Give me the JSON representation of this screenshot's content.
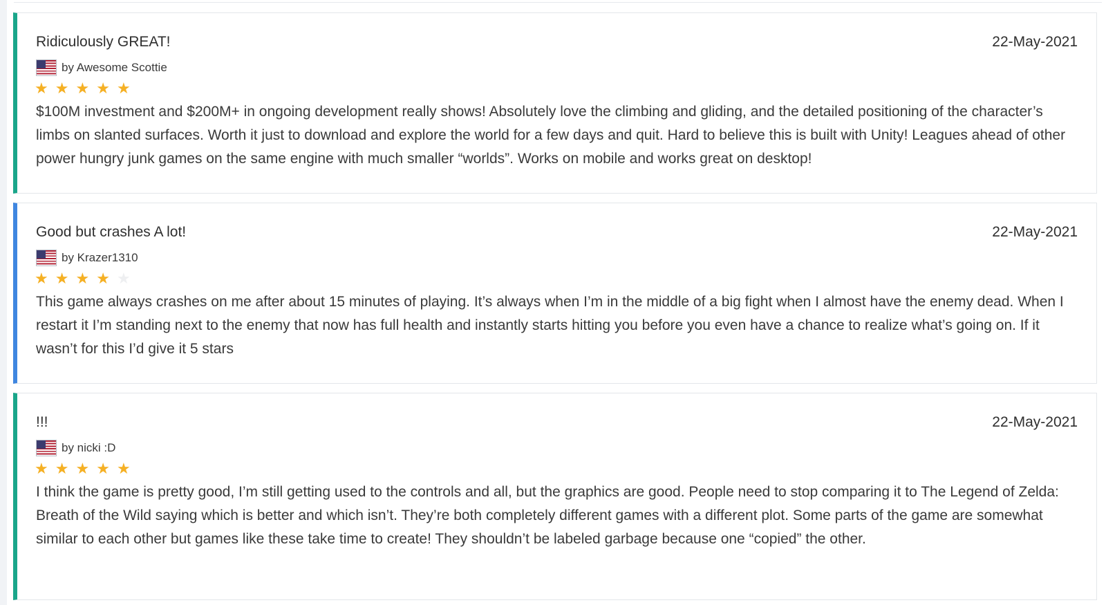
{
  "colors": {
    "accent_green": "#1aa68a",
    "accent_blue": "#3f86e0",
    "star_filled": "#f5b024",
    "star_empty": "#eeeff1"
  },
  "reviews": [
    {
      "title": "Ridiculously GREAT!",
      "date": "22-May-2021",
      "author": "by Awesome Scottie",
      "flag": "us-flag-icon",
      "rating": 5,
      "max_rating": 5,
      "body": "$100M investment and $200M+ in ongoing development really shows! Absolutely love the climbing and gliding, and the detailed positioning of the character’s limbs on slanted surfaces. Worth it just to download and explore the world for a few days and quit. Hard to believe this is built with Unity! Leagues ahead of other power hungry junk games on the same engine with much smaller “worlds”. Works on mobile and works great on desktop!"
    },
    {
      "title": "Good but crashes A lot!",
      "date": "22-May-2021",
      "author": "by Krazer1310",
      "flag": "us-flag-icon",
      "rating": 4,
      "max_rating": 5,
      "body": "This game always crashes on me after about 15 minutes of playing. It’s always when I’m in the middle of a big fight when I almost have the enemy dead. When I restart it I’m standing next to the enemy that now has full health and instantly starts hitting you before you even have a chance to realize what’s going on. If it wasn’t for this I’d give it 5 stars"
    },
    {
      "title": "!!!",
      "date": "22-May-2021",
      "author": "by nicki :D",
      "flag": "us-flag-icon",
      "rating": 5,
      "max_rating": 5,
      "body": "I think the game is pretty good, I’m still getting used to the controls and all, but the graphics are good. People need to stop comparing it to The Legend of Zelda: Breath of the Wild saying which is better and which isn’t. They’re both completely different games with a different plot. Some parts of the game are somewhat similar to each other but games like these take time to create! They shouldn’t be labeled garbage because one “copied” the other."
    }
  ]
}
